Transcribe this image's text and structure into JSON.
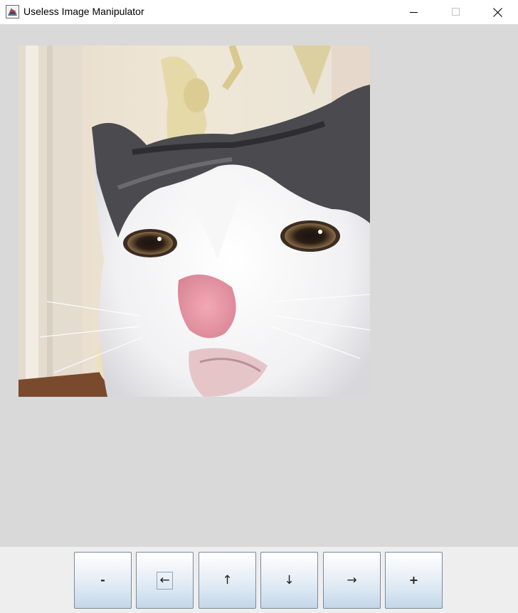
{
  "window": {
    "title": "Useless Image Manipulator"
  },
  "image": {
    "description_icon": "cat-photo-image"
  },
  "controls": [
    {
      "id": "zoom-out",
      "label": "-"
    },
    {
      "id": "left",
      "label": "←"
    },
    {
      "id": "up",
      "label": "↑"
    },
    {
      "id": "down",
      "label": "↓"
    },
    {
      "id": "right",
      "label": "→"
    },
    {
      "id": "zoom-in",
      "label": "+"
    }
  ],
  "colors": {
    "content_bg": "#d9d9d9",
    "button_bar_bg": "#eeeeee",
    "titlebar_bg": "#ffffff"
  }
}
